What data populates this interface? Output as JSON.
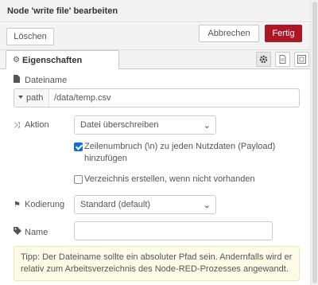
{
  "header": {
    "title": "Node 'write file' bearbeiten"
  },
  "toolbar": {
    "delete_label": "Löschen",
    "cancel_label": "Abbrechen",
    "done_label": "Fertig",
    "done_color": "#ad1625"
  },
  "tabs": {
    "properties_label": "Eigenschaften",
    "side_buttons": [
      "gear-icon",
      "description-icon",
      "appearance-icon"
    ]
  },
  "form": {
    "filename": {
      "label": "Dateiname",
      "type_label": "path",
      "value": "/data/temp.csv"
    },
    "action": {
      "label": "Aktion",
      "selected": "Datei überschreiben"
    },
    "append_newline": {
      "checked": true,
      "label_line1": "Zeilenumbruch (\\n) zu jeden Nutzdaten (Payload)",
      "label_line2": "hinzufügen"
    },
    "create_dir": {
      "checked": false,
      "label": "Verzeichnis erstellen, wenn nicht vorhanden"
    },
    "encoding": {
      "label": "Kodierung",
      "selected": "Standard (default)"
    },
    "name": {
      "label": "Name",
      "value": ""
    }
  },
  "tip": {
    "line1": "Tipp: Der Dateiname sollte ein absoluter Pfad sein. Andernfalls wird er",
    "line2": "relativ zum Arbeitsverzeichnis des Node-RED-Prozesses angewandt."
  }
}
